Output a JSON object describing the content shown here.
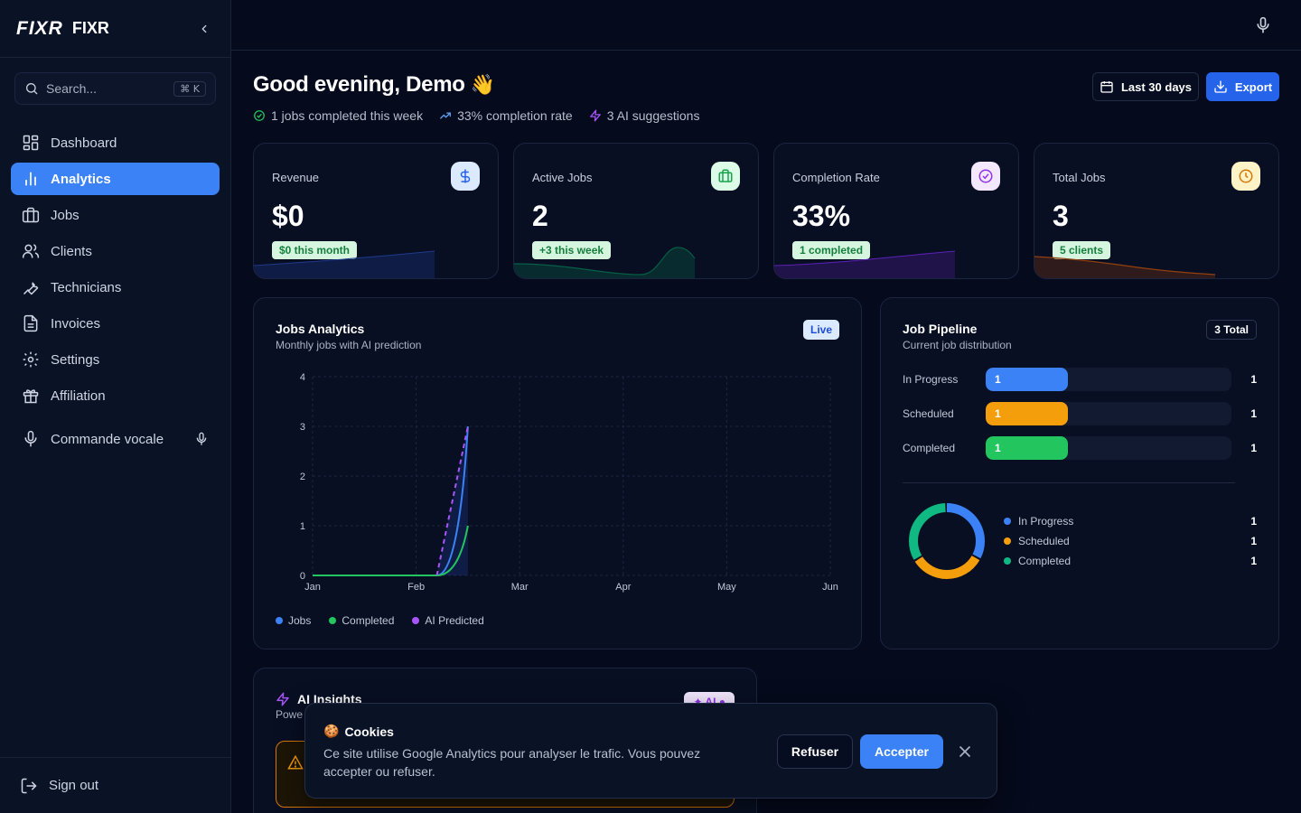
{
  "brand": {
    "logo": "FIXR",
    "name": "FIXR"
  },
  "search": {
    "placeholder": "Search...",
    "shortcut": "⌘ K"
  },
  "sidebar": {
    "items": [
      {
        "label": "Dashboard",
        "icon": "dashboard-icon"
      },
      {
        "label": "Analytics",
        "icon": "bar-chart-icon",
        "active": true
      },
      {
        "label": "Jobs",
        "icon": "briefcase-icon"
      },
      {
        "label": "Clients",
        "icon": "users-icon"
      },
      {
        "label": "Technicians",
        "icon": "wrench-icon"
      },
      {
        "label": "Invoices",
        "icon": "file-text-icon"
      },
      {
        "label": "Settings",
        "icon": "gear-icon"
      },
      {
        "label": "Affiliation",
        "icon": "gift-icon"
      }
    ],
    "voice_label": "Commande vocale",
    "signout_label": "Sign out"
  },
  "header": {
    "greeting": "Good evening, Demo",
    "emoji": "👋",
    "stats": [
      {
        "text": "1 jobs completed this week",
        "icon": "check-circle-icon"
      },
      {
        "text": "33% completion rate",
        "icon": "trending-up-icon"
      },
      {
        "text": "3 AI suggestions",
        "icon": "zap-icon"
      }
    ],
    "range_label": "Last 30 days",
    "export_label": "Export"
  },
  "stat_cards": [
    {
      "label": "Revenue",
      "value": "$0",
      "badge": "$0 this month",
      "icon": "dollar-icon",
      "accent": "#60a5fa"
    },
    {
      "label": "Active Jobs",
      "value": "2",
      "badge": "+3 this week",
      "icon": "briefcase-icon",
      "accent": "#22c55e"
    },
    {
      "label": "Completion Rate",
      "value": "33%",
      "badge": "1 completed",
      "icon": "check-circle-icon",
      "accent": "#a855f7"
    },
    {
      "label": "Total Jobs",
      "value": "3",
      "badge": "5 clients",
      "icon": "clock-icon",
      "accent": "#f59e0b"
    }
  ],
  "jobs_analytics": {
    "title": "Jobs Analytics",
    "subtitle": "Monthly jobs with AI prediction",
    "badge": "Live",
    "legend": [
      "Jobs",
      "Completed",
      "AI Predicted"
    ]
  },
  "chart_data": {
    "type": "line",
    "x": [
      "Jan",
      "Feb",
      "Mar",
      "Apr",
      "May",
      "Jun"
    ],
    "yticks": [
      0,
      1,
      2,
      3,
      4
    ],
    "ylim": [
      0,
      4
    ],
    "grid": true,
    "legend_position": "bottom-left",
    "series": [
      {
        "name": "Jobs",
        "color": "#3b82f6",
        "points": [
          [
            0,
            0
          ],
          [
            1.2,
            0
          ],
          [
            1.5,
            3
          ]
        ]
      },
      {
        "name": "Completed",
        "color": "#22c55e",
        "points": [
          [
            0,
            0
          ],
          [
            1.2,
            0
          ],
          [
            1.5,
            1
          ]
        ]
      },
      {
        "name": "AI Predicted",
        "color": "#a855f7",
        "dashed": true,
        "points": [
          [
            1.2,
            0
          ],
          [
            1.5,
            3
          ]
        ]
      }
    ]
  },
  "pipeline": {
    "title": "Job Pipeline",
    "subtitle": "Current job distribution",
    "total_badge": "3 Total",
    "rows": [
      {
        "label": "In Progress",
        "value": "1",
        "count": "1",
        "fraction": 0.333,
        "color": "#3b82f6"
      },
      {
        "label": "Scheduled",
        "value": "1",
        "count": "1",
        "fraction": 0.333,
        "color": "#f59e0b"
      },
      {
        "label": "Completed",
        "value": "1",
        "count": "1",
        "fraction": 0.333,
        "color": "#22c55e"
      }
    ],
    "donut": [
      {
        "label": "In Progress",
        "value": "1",
        "color": "#3b82f6"
      },
      {
        "label": "Scheduled",
        "value": "1",
        "color": "#f59e0b"
      },
      {
        "label": "Completed",
        "value": "1",
        "color": "#10b981"
      }
    ]
  },
  "ai_insights": {
    "title": "AI Insights",
    "subtitle": "Powe",
    "badge": "✦ AI ●"
  },
  "cookie": {
    "emoji": "🍪",
    "title": "Cookies",
    "text": "Ce site utilise Google Analytics pour analyser le trafic. Vous pouvez accepter ou refuser.",
    "refuse": "Refuser",
    "accept": "Accepter"
  }
}
